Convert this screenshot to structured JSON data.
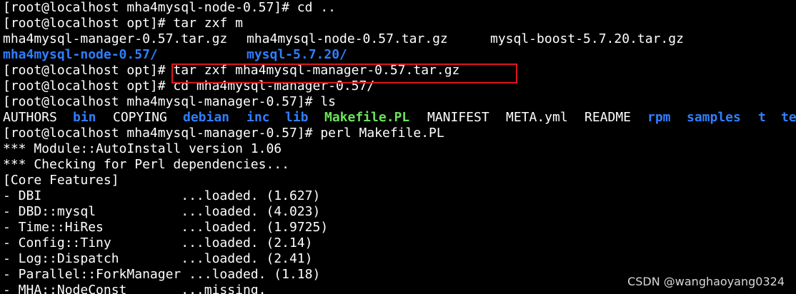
{
  "terminal": {
    "lines": [
      "[root@localhost mha4mysql-node-0.57]# cd ..",
      "[root@localhost opt]# tar zxf m",
      "",
      "",
      "[root@localhost opt]# tar zxf mha4mysql-manager-0.57.tar.gz",
      "[root@localhost opt]# cd mha4mysql-manager-0.57/",
      "[root@localhost mha4mysql-manager-0.57]# ls",
      "",
      "[root@localhost mha4mysql-manager-0.57]# perl Makefile.PL",
      "*** Module::AutoInstall version 1.06",
      "*** Checking for Perl dependencies...",
      "[Core Features]",
      "- DBI                  ...loaded. (1.627)",
      "- DBD::mysql           ...loaded. (4.023)",
      "- Time::HiRes          ...loaded. (1.9725)",
      "- Config::Tiny         ...loaded. (2.14)",
      "- Log::Dispatch        ...loaded. (2.41)",
      "- Parallel::ForkManager ...loaded. (1.18)",
      "- MHA::NodeConst       ...missing."
    ],
    "completion_files": {
      "row1": [
        "mha4mysql-manager-0.57.tar.gz",
        "mha4mysql-node-0.57.tar.gz",
        "mysql-boost-5.7.20.tar.gz"
      ],
      "row2": [
        "mha4mysql-node-0.57/",
        "mysql-5.7.20/"
      ]
    },
    "ls_output": [
      {
        "name": "AUTHORS",
        "kind": "file"
      },
      {
        "name": "bin",
        "kind": "dir"
      },
      {
        "name": "COPYING",
        "kind": "file"
      },
      {
        "name": "debian",
        "kind": "dir"
      },
      {
        "name": "inc",
        "kind": "dir"
      },
      {
        "name": "lib",
        "kind": "dir"
      },
      {
        "name": "Makefile.PL",
        "kind": "exec"
      },
      {
        "name": "MANIFEST",
        "kind": "file"
      },
      {
        "name": "META.yml",
        "kind": "file"
      },
      {
        "name": "README",
        "kind": "file"
      },
      {
        "name": "rpm",
        "kind": "dir"
      },
      {
        "name": "samples",
        "kind": "dir"
      },
      {
        "name": "t",
        "kind": "dir"
      },
      {
        "name": "te",
        "kind": "dir"
      }
    ]
  },
  "watermark": "CSDN @wanghaoyang0324",
  "colors": {
    "background": "#000000",
    "text": "#ffffff",
    "directory": "#2f7fff",
    "executable": "#6be25b",
    "highlight_border": "#e0141e"
  }
}
